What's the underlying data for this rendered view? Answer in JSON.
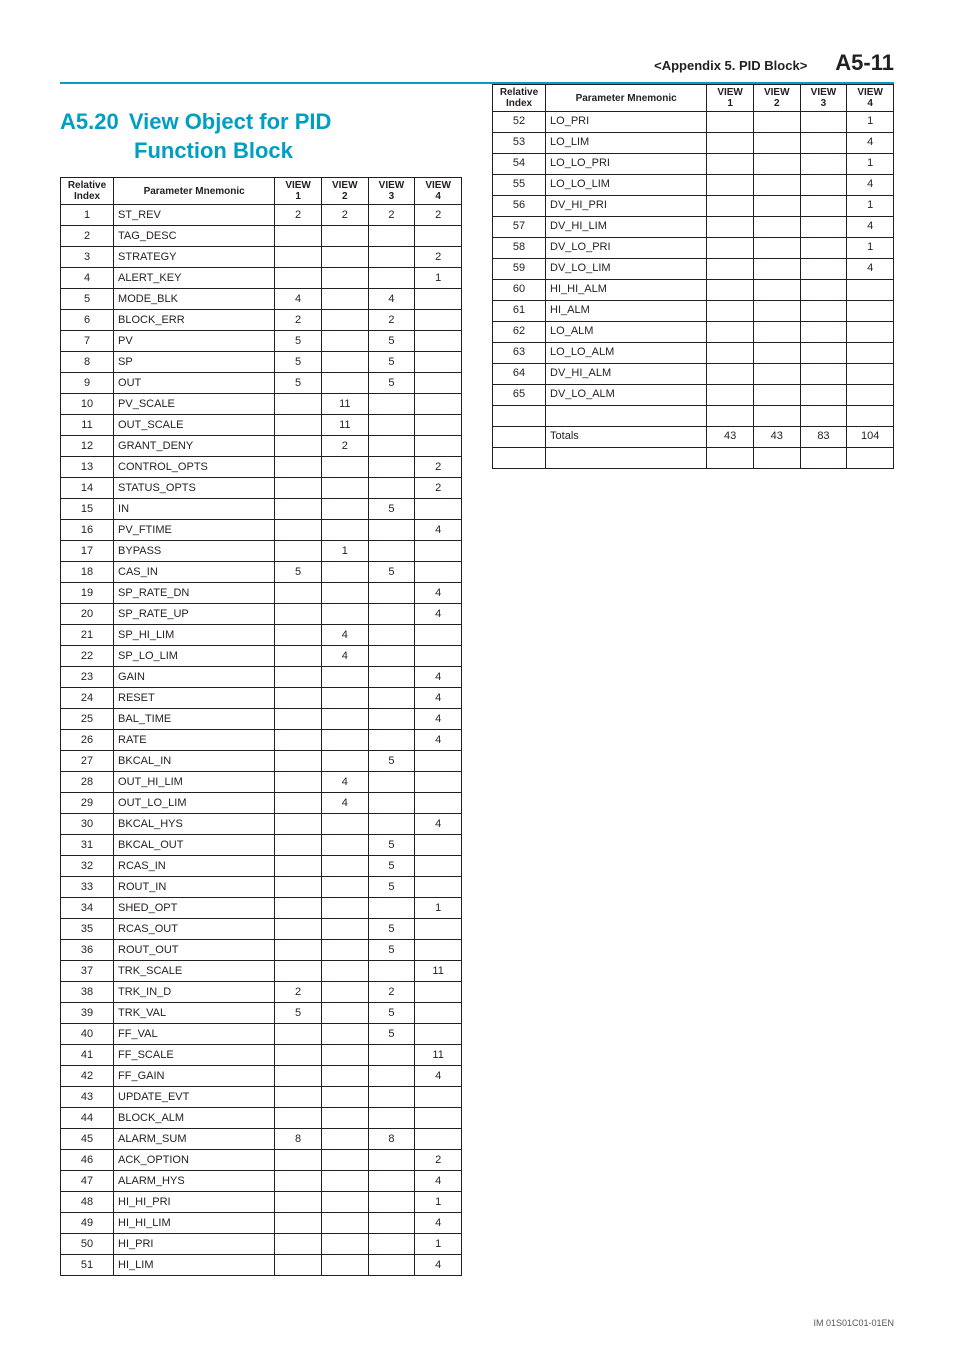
{
  "header": {
    "appendix": "<Appendix 5.  PID Block>",
    "page": "A5-11"
  },
  "section": {
    "number": "A5.20",
    "title_line1": "View Object for PID",
    "title_line2": "Function Block"
  },
  "table_headers": {
    "rel_idx_l1": "Relative",
    "rel_idx_l2": "Index",
    "mnem": "Parameter Mnemonic",
    "v1_l1": "VIEW",
    "v1_l2": "1",
    "v2_l1": "VIEW",
    "v2_l2": "2",
    "v3_l1": "VIEW",
    "v3_l2": "3",
    "v4_l1": "VIEW",
    "v4_l2": "4"
  },
  "rows_left": [
    {
      "idx": "1",
      "mnem": "ST_REV",
      "v1": "2",
      "v2": "2",
      "v3": "2",
      "v4": "2"
    },
    {
      "idx": "2",
      "mnem": "TAG_DESC",
      "v1": "",
      "v2": "",
      "v3": "",
      "v4": ""
    },
    {
      "idx": "3",
      "mnem": "STRATEGY",
      "v1": "",
      "v2": "",
      "v3": "",
      "v4": "2"
    },
    {
      "idx": "4",
      "mnem": "ALERT_KEY",
      "v1": "",
      "v2": "",
      "v3": "",
      "v4": "1"
    },
    {
      "idx": "5",
      "mnem": "MODE_BLK",
      "v1": "4",
      "v2": "",
      "v3": "4",
      "v4": ""
    },
    {
      "idx": "6",
      "mnem": "BLOCK_ERR",
      "v1": "2",
      "v2": "",
      "v3": "2",
      "v4": ""
    },
    {
      "idx": "7",
      "mnem": "PV",
      "v1": "5",
      "v2": "",
      "v3": "5",
      "v4": ""
    },
    {
      "idx": "8",
      "mnem": "SP",
      "v1": "5",
      "v2": "",
      "v3": "5",
      "v4": ""
    },
    {
      "idx": "9",
      "mnem": "OUT",
      "v1": "5",
      "v2": "",
      "v3": "5",
      "v4": ""
    },
    {
      "idx": "10",
      "mnem": "PV_SCALE",
      "v1": "",
      "v2": "11",
      "v3": "",
      "v4": ""
    },
    {
      "idx": "11",
      "mnem": "OUT_SCALE",
      "v1": "",
      "v2": "11",
      "v3": "",
      "v4": ""
    },
    {
      "idx": "12",
      "mnem": "GRANT_DENY",
      "v1": "",
      "v2": "2",
      "v3": "",
      "v4": ""
    },
    {
      "idx": "13",
      "mnem": "CONTROL_OPTS",
      "v1": "",
      "v2": "",
      "v3": "",
      "v4": "2"
    },
    {
      "idx": "14",
      "mnem": "STATUS_OPTS",
      "v1": "",
      "v2": "",
      "v3": "",
      "v4": "2"
    },
    {
      "idx": "15",
      "mnem": "IN",
      "v1": "",
      "v2": "",
      "v3": "5",
      "v4": ""
    },
    {
      "idx": "16",
      "mnem": "PV_FTIME",
      "v1": "",
      "v2": "",
      "v3": "",
      "v4": "4"
    },
    {
      "idx": "17",
      "mnem": "BYPASS",
      "v1": "",
      "v2": "1",
      "v3": "",
      "v4": ""
    },
    {
      "idx": "18",
      "mnem": "CAS_IN",
      "v1": "5",
      "v2": "",
      "v3": "5",
      "v4": ""
    },
    {
      "idx": "19",
      "mnem": "SP_RATE_DN",
      "v1": "",
      "v2": "",
      "v3": "",
      "v4": "4"
    },
    {
      "idx": "20",
      "mnem": "SP_RATE_UP",
      "v1": "",
      "v2": "",
      "v3": "",
      "v4": "4"
    },
    {
      "idx": "21",
      "mnem": "SP_HI_LIM",
      "v1": "",
      "v2": "4",
      "v3": "",
      "v4": ""
    },
    {
      "idx": "22",
      "mnem": "SP_LO_LIM",
      "v1": "",
      "v2": "4",
      "v3": "",
      "v4": ""
    },
    {
      "idx": "23",
      "mnem": "GAIN",
      "v1": "",
      "v2": "",
      "v3": "",
      "v4": "4"
    },
    {
      "idx": "24",
      "mnem": "RESET",
      "v1": "",
      "v2": "",
      "v3": "",
      "v4": "4"
    },
    {
      "idx": "25",
      "mnem": "BAL_TIME",
      "v1": "",
      "v2": "",
      "v3": "",
      "v4": "4"
    },
    {
      "idx": "26",
      "mnem": "RATE",
      "v1": "",
      "v2": "",
      "v3": "",
      "v4": "4"
    },
    {
      "idx": "27",
      "mnem": "BKCAL_IN",
      "v1": "",
      "v2": "",
      "v3": "5",
      "v4": ""
    },
    {
      "idx": "28",
      "mnem": "OUT_HI_LIM",
      "v1": "",
      "v2": "4",
      "v3": "",
      "v4": ""
    },
    {
      "idx": "29",
      "mnem": "OUT_LO_LIM",
      "v1": "",
      "v2": "4",
      "v3": "",
      "v4": ""
    },
    {
      "idx": "30",
      "mnem": "BKCAL_HYS",
      "v1": "",
      "v2": "",
      "v3": "",
      "v4": "4"
    },
    {
      "idx": "31",
      "mnem": "BKCAL_OUT",
      "v1": "",
      "v2": "",
      "v3": "5",
      "v4": ""
    },
    {
      "idx": "32",
      "mnem": "RCAS_IN",
      "v1": "",
      "v2": "",
      "v3": "5",
      "v4": ""
    },
    {
      "idx": "33",
      "mnem": "ROUT_IN",
      "v1": "",
      "v2": "",
      "v3": "5",
      "v4": ""
    },
    {
      "idx": "34",
      "mnem": "SHED_OPT",
      "v1": "",
      "v2": "",
      "v3": "",
      "v4": "1"
    },
    {
      "idx": "35",
      "mnem": "RCAS_OUT",
      "v1": "",
      "v2": "",
      "v3": "5",
      "v4": ""
    },
    {
      "idx": "36",
      "mnem": "ROUT_OUT",
      "v1": "",
      "v2": "",
      "v3": "5",
      "v4": ""
    },
    {
      "idx": "37",
      "mnem": "TRK_SCALE",
      "v1": "",
      "v2": "",
      "v3": "",
      "v4": "11"
    },
    {
      "idx": "38",
      "mnem": "TRK_IN_D",
      "v1": "2",
      "v2": "",
      "v3": "2",
      "v4": ""
    },
    {
      "idx": "39",
      "mnem": "TRK_VAL",
      "v1": "5",
      "v2": "",
      "v3": "5",
      "v4": ""
    },
    {
      "idx": "40",
      "mnem": "FF_VAL",
      "v1": "",
      "v2": "",
      "v3": "5",
      "v4": ""
    },
    {
      "idx": "41",
      "mnem": "FF_SCALE",
      "v1": "",
      "v2": "",
      "v3": "",
      "v4": "11"
    },
    {
      "idx": "42",
      "mnem": "FF_GAIN",
      "v1": "",
      "v2": "",
      "v3": "",
      "v4": "4"
    },
    {
      "idx": "43",
      "mnem": "UPDATE_EVT",
      "v1": "",
      "v2": "",
      "v3": "",
      "v4": ""
    },
    {
      "idx": "44",
      "mnem": "BLOCK_ALM",
      "v1": "",
      "v2": "",
      "v3": "",
      "v4": ""
    },
    {
      "idx": "45",
      "mnem": "ALARM_SUM",
      "v1": "8",
      "v2": "",
      "v3": "8",
      "v4": ""
    },
    {
      "idx": "46",
      "mnem": "ACK_OPTION",
      "v1": "",
      "v2": "",
      "v3": "",
      "v4": "2"
    },
    {
      "idx": "47",
      "mnem": "ALARM_HYS",
      "v1": "",
      "v2": "",
      "v3": "",
      "v4": "4"
    },
    {
      "idx": "48",
      "mnem": "HI_HI_PRI",
      "v1": "",
      "v2": "",
      "v3": "",
      "v4": "1"
    },
    {
      "idx": "49",
      "mnem": "HI_HI_LIM",
      "v1": "",
      "v2": "",
      "v3": "",
      "v4": "4"
    },
    {
      "idx": "50",
      "mnem": "HI_PRI",
      "v1": "",
      "v2": "",
      "v3": "",
      "v4": "1"
    },
    {
      "idx": "51",
      "mnem": "HI_LIM",
      "v1": "",
      "v2": "",
      "v3": "",
      "v4": "4"
    }
  ],
  "rows_right": [
    {
      "idx": "52",
      "mnem": "LO_PRI",
      "v1": "",
      "v2": "",
      "v3": "",
      "v4": "1"
    },
    {
      "idx": "53",
      "mnem": "LO_LIM",
      "v1": "",
      "v2": "",
      "v3": "",
      "v4": "4"
    },
    {
      "idx": "54",
      "mnem": "LO_LO_PRI",
      "v1": "",
      "v2": "",
      "v3": "",
      "v4": "1"
    },
    {
      "idx": "55",
      "mnem": "LO_LO_LIM",
      "v1": "",
      "v2": "",
      "v3": "",
      "v4": "4"
    },
    {
      "idx": "56",
      "mnem": "DV_HI_PRI",
      "v1": "",
      "v2": "",
      "v3": "",
      "v4": "1"
    },
    {
      "idx": "57",
      "mnem": "DV_HI_LIM",
      "v1": "",
      "v2": "",
      "v3": "",
      "v4": "4"
    },
    {
      "idx": "58",
      "mnem": "DV_LO_PRI",
      "v1": "",
      "v2": "",
      "v3": "",
      "v4": "1"
    },
    {
      "idx": "59",
      "mnem": "DV_LO_LIM",
      "v1": "",
      "v2": "",
      "v3": "",
      "v4": "4"
    },
    {
      "idx": "60",
      "mnem": "HI_HI_ALM",
      "v1": "",
      "v2": "",
      "v3": "",
      "v4": ""
    },
    {
      "idx": "61",
      "mnem": "HI_ALM",
      "v1": "",
      "v2": "",
      "v3": "",
      "v4": ""
    },
    {
      "idx": "62",
      "mnem": "LO_ALM",
      "v1": "",
      "v2": "",
      "v3": "",
      "v4": ""
    },
    {
      "idx": "63",
      "mnem": "LO_LO_ALM",
      "v1": "",
      "v2": "",
      "v3": "",
      "v4": ""
    },
    {
      "idx": "64",
      "mnem": "DV_HI_ALM",
      "v1": "",
      "v2": "",
      "v3": "",
      "v4": ""
    },
    {
      "idx": "65",
      "mnem": "DV_LO_ALM",
      "v1": "",
      "v2": "",
      "v3": "",
      "v4": ""
    },
    {
      "idx": "",
      "mnem": "",
      "v1": "",
      "v2": "",
      "v3": "",
      "v4": ""
    },
    {
      "idx": "",
      "mnem": "Totals",
      "v1": "43",
      "v2": "43",
      "v3": "83",
      "v4": "104"
    },
    {
      "idx": "",
      "mnem": "",
      "v1": "",
      "v2": "",
      "v3": "",
      "v4": ""
    }
  ],
  "footer": "IM 01S01C01-01EN"
}
